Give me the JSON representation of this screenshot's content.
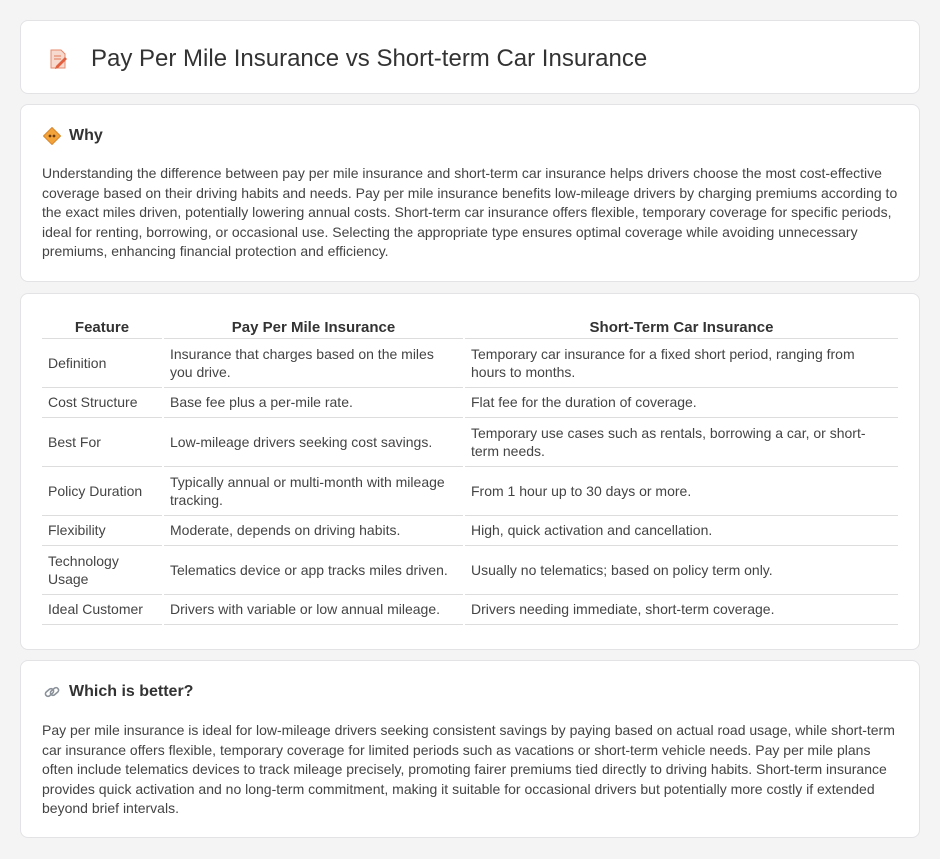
{
  "title": "Pay Per Mile Insurance vs Short-term Car Insurance",
  "why": {
    "heading": "Why",
    "text": "Understanding the difference between pay per mile insurance and short-term car insurance helps drivers choose the most cost-effective coverage based on their driving habits and needs. Pay per mile insurance benefits low-mileage drivers by charging premiums according to the exact miles driven, potentially lowering annual costs. Short-term car insurance offers flexible, temporary coverage for specific periods, ideal for renting, borrowing, or occasional use. Selecting the appropriate type ensures optimal coverage while avoiding unnecessary premiums, enhancing financial protection and efficiency."
  },
  "table": {
    "headers": [
      "Feature",
      "Pay Per Mile Insurance",
      "Short-Term Car Insurance"
    ],
    "rows": [
      [
        "Definition",
        "Insurance that charges based on the miles you drive.",
        "Temporary car insurance for a fixed short period, ranging from hours to months."
      ],
      [
        "Cost Structure",
        "Base fee plus a per-mile rate.",
        "Flat fee for the duration of coverage."
      ],
      [
        "Best For",
        "Low-mileage drivers seeking cost savings.",
        "Temporary use cases such as rentals, borrowing a car, or short-term needs."
      ],
      [
        "Policy Duration",
        "Typically annual or multi-month with mileage tracking.",
        "From 1 hour up to 30 days or more."
      ],
      [
        "Flexibility",
        "Moderate, depends on driving habits.",
        "High, quick activation and cancellation."
      ],
      [
        "Technology Usage",
        "Telematics device or app tracks miles driven.",
        "Usually no telematics; based on policy term only."
      ],
      [
        "Ideal Customer",
        "Drivers with variable or low annual mileage.",
        "Drivers needing immediate, short-term coverage."
      ]
    ]
  },
  "better": {
    "heading": "Which is better?",
    "text": "Pay per mile insurance is ideal for low-mileage drivers seeking consistent savings by paying based on actual road usage, while short-term car insurance offers flexible, temporary coverage for limited periods such as vacations or short-term vehicle needs. Pay per mile plans often include telematics devices to track mileage precisely, promoting fairer premiums tied directly to driving habits. Short-term insurance provides quick activation and no long-term commitment, making it suitable for occasional drivers but potentially more costly if extended beyond brief intervals."
  },
  "icons": {
    "title": "document-pencil-icon",
    "why": "diamond-sign-icon",
    "better": "link-icon"
  }
}
